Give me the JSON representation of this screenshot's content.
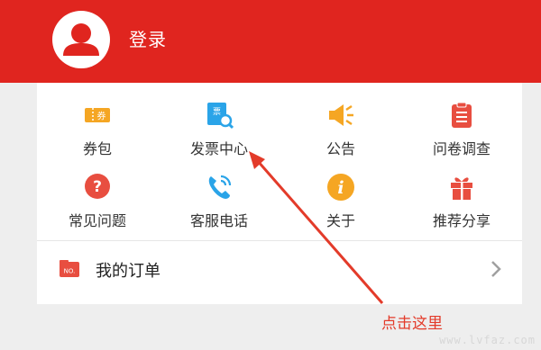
{
  "colors": {
    "red": "#e0251f",
    "orange": "#f5a623",
    "blue": "#2aa4e8",
    "grid_red": "#e84e40",
    "annotation": "#e33b2a"
  },
  "header": {
    "login_label": "登录"
  },
  "grid": [
    {
      "label": "券包",
      "icon": "coupon-icon"
    },
    {
      "label": "发票中心",
      "icon": "invoice-search-icon"
    },
    {
      "label": "公告",
      "icon": "megaphone-icon"
    },
    {
      "label": "问卷调查",
      "icon": "clipboard-icon"
    },
    {
      "label": "常见问题",
      "icon": "question-icon"
    },
    {
      "label": "客服电话",
      "icon": "phone-icon"
    },
    {
      "label": "关于",
      "icon": "info-icon"
    },
    {
      "label": "推荐分享",
      "icon": "gift-icon"
    }
  ],
  "orders": {
    "label": "我的订单",
    "icon_text": "NO."
  },
  "annotation": {
    "text": "点击这里"
  },
  "watermark": {
    "text": "www.lvfaz.com"
  }
}
